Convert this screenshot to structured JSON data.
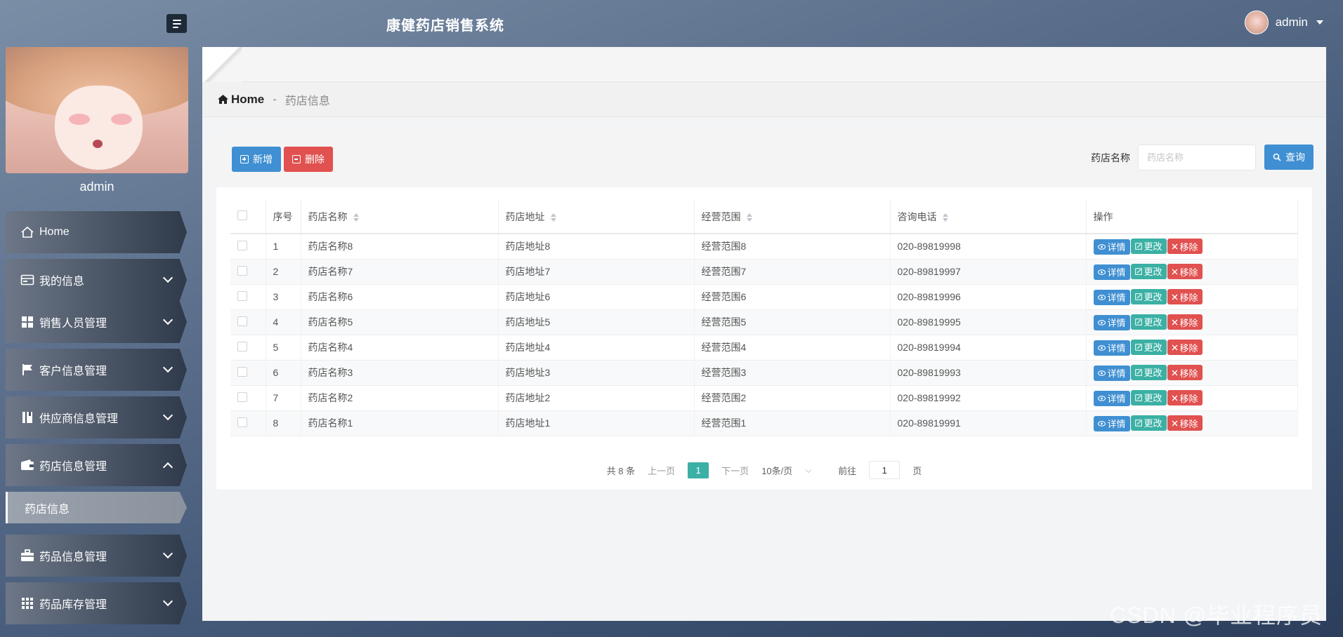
{
  "header": {
    "app_title": "康健药店销售系统",
    "user_name": "admin"
  },
  "sidebar": {
    "profile_name": "admin",
    "items": [
      {
        "label": "Home",
        "icon": "home-icon"
      },
      {
        "label": "我的信息",
        "icon": "card-icon"
      },
      {
        "label": "销售人员管理",
        "icon": "grid-icon"
      },
      {
        "label": "客户信息管理",
        "icon": "flag-icon"
      },
      {
        "label": "供应商信息管理",
        "icon": "book-icon"
      },
      {
        "label": "药店信息管理",
        "icon": "wallet-icon"
      },
      {
        "label": "药品信息管理",
        "icon": "briefcase-icon"
      },
      {
        "label": "药品库存管理",
        "icon": "apps-icon"
      }
    ],
    "active_sub": "药店信息"
  },
  "breadcrumb": {
    "home": "Home",
    "separator": "-",
    "current": "药店信息"
  },
  "toolbar": {
    "add_label": "新增",
    "delete_label": "删除",
    "search_label": "药店名称",
    "search_placeholder": "药店名称",
    "query_label": "查询"
  },
  "table": {
    "headers": [
      "序号",
      "药店名称",
      "药店地址",
      "经营范围",
      "咨询电话",
      "操作"
    ],
    "actions": {
      "view": "详情",
      "edit": "更改",
      "remove": "移除"
    },
    "rows": [
      {
        "no": "1",
        "name": "药店名称8",
        "addr": "药店地址8",
        "scope": "经营范围8",
        "phone": "020-89819998"
      },
      {
        "no": "2",
        "name": "药店名称7",
        "addr": "药店地址7",
        "scope": "经营范围7",
        "phone": "020-89819997"
      },
      {
        "no": "3",
        "name": "药店名称6",
        "addr": "药店地址6",
        "scope": "经营范围6",
        "phone": "020-89819996"
      },
      {
        "no": "4",
        "name": "药店名称5",
        "addr": "药店地址5",
        "scope": "经营范围5",
        "phone": "020-89819995"
      },
      {
        "no": "5",
        "name": "药店名称4",
        "addr": "药店地址4",
        "scope": "经营范围4",
        "phone": "020-89819994"
      },
      {
        "no": "6",
        "name": "药店名称3",
        "addr": "药店地址3",
        "scope": "经营范围3",
        "phone": "020-89819993"
      },
      {
        "no": "7",
        "name": "药店名称2",
        "addr": "药店地址2",
        "scope": "经营范围2",
        "phone": "020-89819992"
      },
      {
        "no": "8",
        "name": "药店名称1",
        "addr": "药店地址1",
        "scope": "经营范围1",
        "phone": "020-89819991"
      }
    ]
  },
  "pager": {
    "total": "共 8 条",
    "prev": "上一页",
    "page": "1",
    "next": "下一页",
    "size": "10条/页",
    "goto_prefix": "前往",
    "goto_value": "1",
    "goto_suffix": "页"
  },
  "watermark": "CSDN @毕业程序员"
}
